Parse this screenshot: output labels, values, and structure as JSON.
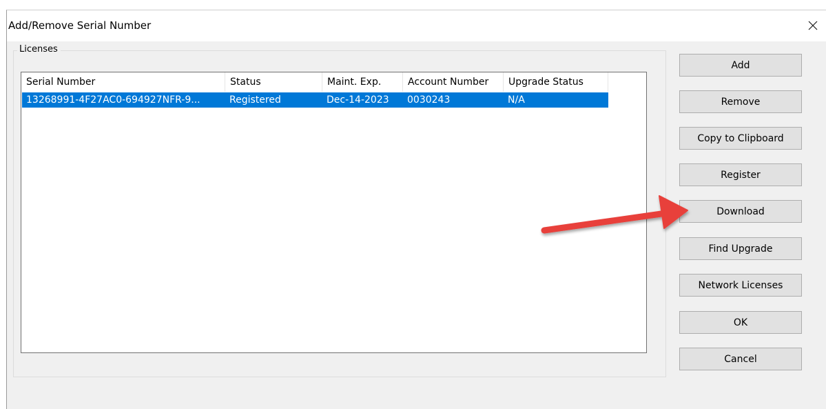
{
  "window": {
    "title": "Add/Remove Serial Number",
    "close_symbol": "✕"
  },
  "licenses": {
    "group_label": "Licenses",
    "columns": [
      "Serial Number",
      "Status",
      "Maint. Exp.",
      "Account Number",
      "Upgrade Status"
    ],
    "rows": [
      {
        "serial_number": "13268991-4F27AC0-694927NFR-9...",
        "status": "Registered",
        "maint_exp": "Dec-14-2023",
        "account_number": "0030243",
        "upgrade_status": "N/A",
        "selected": true
      }
    ]
  },
  "buttons": {
    "add": "Add",
    "remove": "Remove",
    "copy": "Copy to Clipboard",
    "register": "Register",
    "download": "Download",
    "find_upgrade": "Find Upgrade",
    "network_licenses": "Network Licenses",
    "ok": "OK",
    "cancel": "Cancel"
  },
  "annotation": {
    "arrow_color": "#e8403a",
    "points_to": "Download"
  },
  "colors": {
    "selection": "#0078d7",
    "dialog_bg": "#f0f0f0",
    "button_bg": "#e1e1e1"
  }
}
